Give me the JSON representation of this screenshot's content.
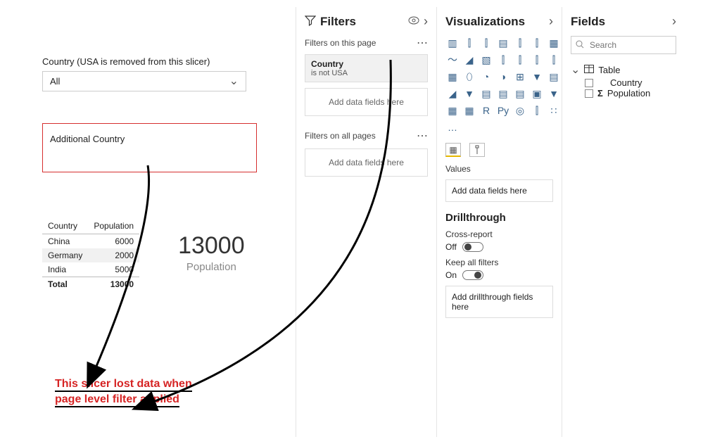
{
  "canvas": {
    "slicer1": {
      "title": "Country (USA is removed from this slicer)",
      "value": "All"
    },
    "slicer2": {
      "title": "Additional Country"
    },
    "table": {
      "headers": [
        "Country",
        "Population"
      ],
      "rows": [
        {
          "c": "China",
          "p": "6000"
        },
        {
          "c": "Germany",
          "p": "2000"
        },
        {
          "c": "India",
          "p": "5000"
        }
      ],
      "total_label": "Total",
      "total_value": "13000"
    },
    "card": {
      "value": "13000",
      "label": "Population"
    },
    "annotation_line1": "This slicer lost data when",
    "annotation_line2": "page level filter applied"
  },
  "filters_pane": {
    "title": "Filters",
    "subhead_page": "Filters on this page",
    "page_filter": {
      "field": "Country",
      "condition": "is not USA"
    },
    "drop_page": "Add data fields here",
    "subhead_all": "Filters on all pages",
    "drop_all": "Add data fields here"
  },
  "viz_pane": {
    "title": "Visualizations",
    "values_label": "Values",
    "values_drop": "Add data fields here",
    "drill_title": "Drillthrough",
    "cross_report_label": "Cross-report",
    "cross_report_state": "Off",
    "keep_filters_label": "Keep all filters",
    "keep_filters_state": "On",
    "drill_drop": "Add drillthrough fields here",
    "viz_icons": [
      "▥",
      "⫿",
      "⫿",
      "▤",
      "⫿",
      "⫿",
      "▦",
      "〜",
      "◢",
      "▧",
      "⫿",
      "⫿",
      "⫿",
      "⫿",
      "▦",
      "⬯",
      "◔",
      "◑",
      "⊞",
      "▼",
      "▤",
      "◢",
      "▼",
      "▤",
      "▤",
      "▤",
      "▣",
      "▼",
      "▦",
      "▦",
      "R",
      "Py",
      "◎",
      "⫿",
      "∷",
      "…"
    ]
  },
  "fields_pane": {
    "title": "Fields",
    "search_placeholder": "Search",
    "table_name": "Table",
    "columns": {
      "country": "Country",
      "population": "Population"
    }
  }
}
